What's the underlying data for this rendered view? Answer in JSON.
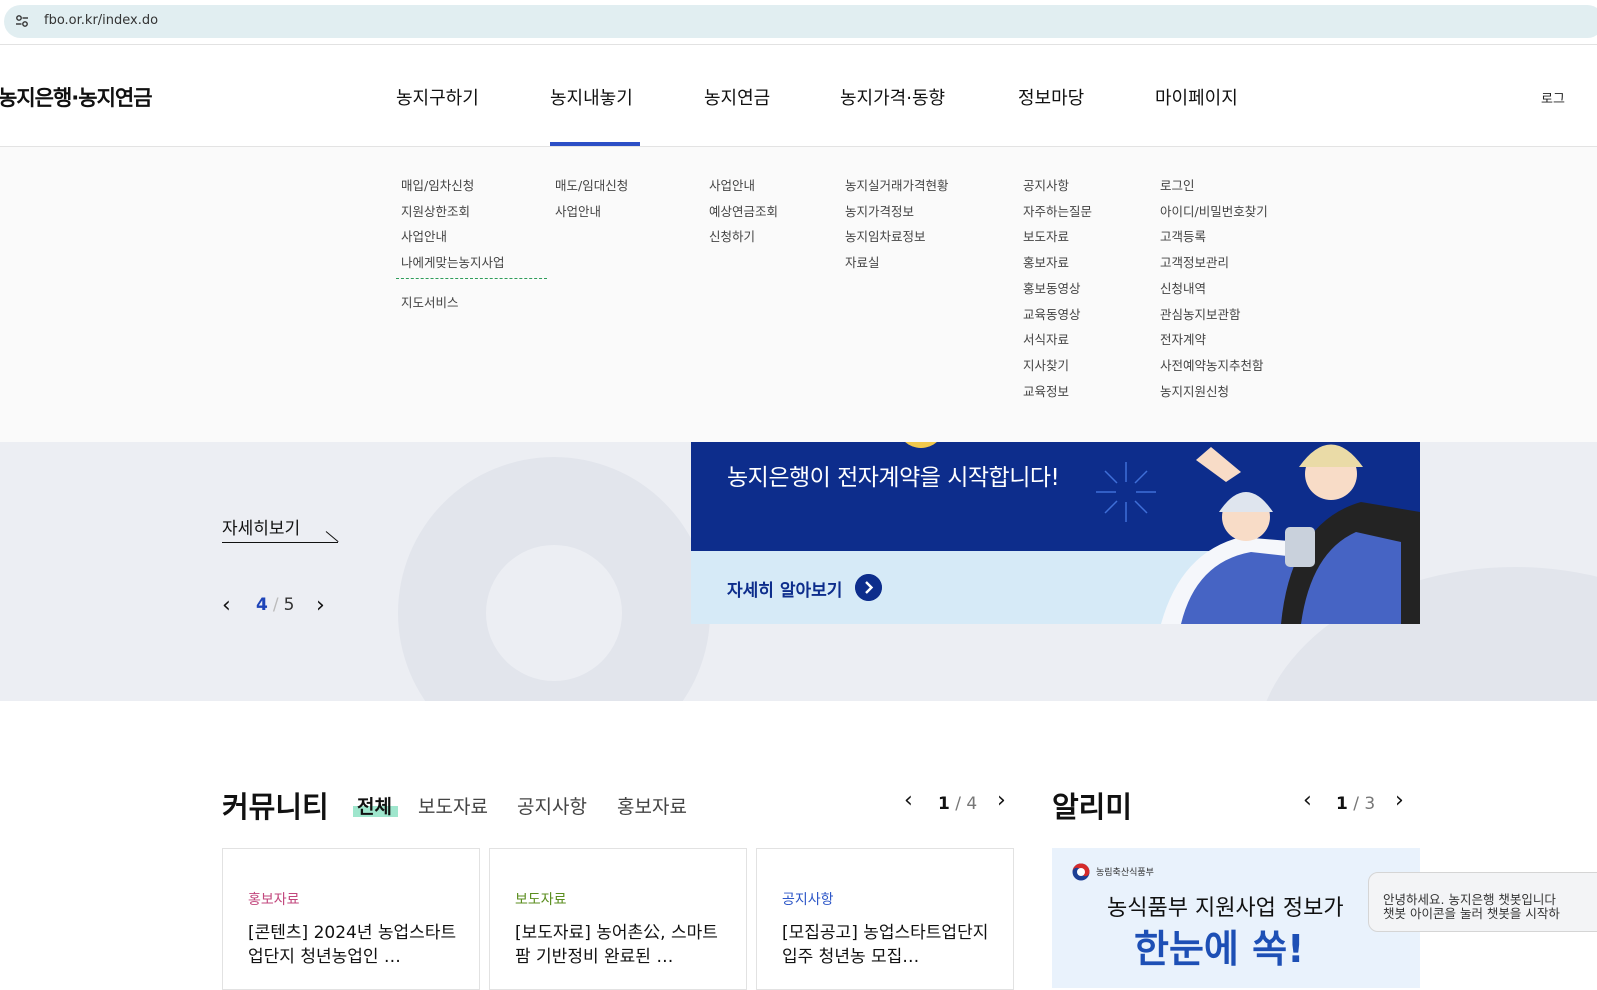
{
  "browser": {
    "url": "fbo.or.kr/index.do",
    "site_info_icon": "tune-icon"
  },
  "header": {
    "logo": "농지은행·농지연금",
    "nav": [
      "농지구하기",
      "농지내놓기",
      "농지연금",
      "농지가격·동향",
      "정보마당",
      "마이페이지"
    ],
    "active_nav": "농지내놓기",
    "login_peek": "로그"
  },
  "megamenu": {
    "col1": [
      "매입/임차신청",
      "지원상한조회",
      "사업안내",
      "나에게맞는농지사업"
    ],
    "col1_extra": "지도서비스",
    "col2": [
      "매도/임대신청",
      "사업안내"
    ],
    "col3": [
      "사업안내",
      "예상연금조회",
      "신청하기"
    ],
    "col4": [
      "농지실거래가격현황",
      "농지가격정보",
      "농지임차료정보",
      "자료실"
    ],
    "col5": [
      "공지사항",
      "자주하는질문",
      "보도자료",
      "홍보자료",
      "홍보동영상",
      "교육동영상",
      "서식자료",
      "지사찾기",
      "교육정보"
    ],
    "col6": [
      "로그인",
      "아이디/비밀번호찾기",
      "고객등록",
      "고객정보관리",
      "신청내역",
      "관심농지보관함",
      "전자계약",
      "사전예약농지추천함",
      "농지지원신청"
    ]
  },
  "banner": {
    "detail": "자세히보기",
    "page_current": "4",
    "page_total": "5",
    "slide_title": "농지은행이 전자계약을 시작합니다!",
    "slide_cta": "자세히 알아보기",
    "colors": {
      "navy": "#0d2d8c",
      "light": "#d6eaf7"
    }
  },
  "community": {
    "title": "커뮤니티",
    "tabs": [
      "전체",
      "보도자료",
      "공지사항",
      "홍보자료"
    ],
    "pager_current": "1",
    "pager_total": "/ 4",
    "cards": [
      {
        "category": "홍보자료",
        "color": "#c2477d",
        "title": "[콘텐츠] 2024년 농업스타트업단지 청년농업인 …"
      },
      {
        "category": "보도자료",
        "color": "#5b8e1f",
        "title": "[보도자료] 농어촌公, 스마트팜 기반정비 완료된 …"
      },
      {
        "category": "공지사항",
        "color": "#2c56c7",
        "title": "[모집공고] 농업스타트업단지 입주 청년농 모집…"
      }
    ]
  },
  "alimi": {
    "title": "알리미",
    "pager_current": "1",
    "pager_total": "/ 3",
    "org": "농림축산식품부",
    "line1": "농식품부 지원사업 정보가",
    "line2": "한눈에 쏙!"
  },
  "chatbot": {
    "line1": "안녕하세요. 농지은행 챗봇입니다",
    "line2": "챗봇 아이콘을 눌러 챗봇을 시작하"
  }
}
